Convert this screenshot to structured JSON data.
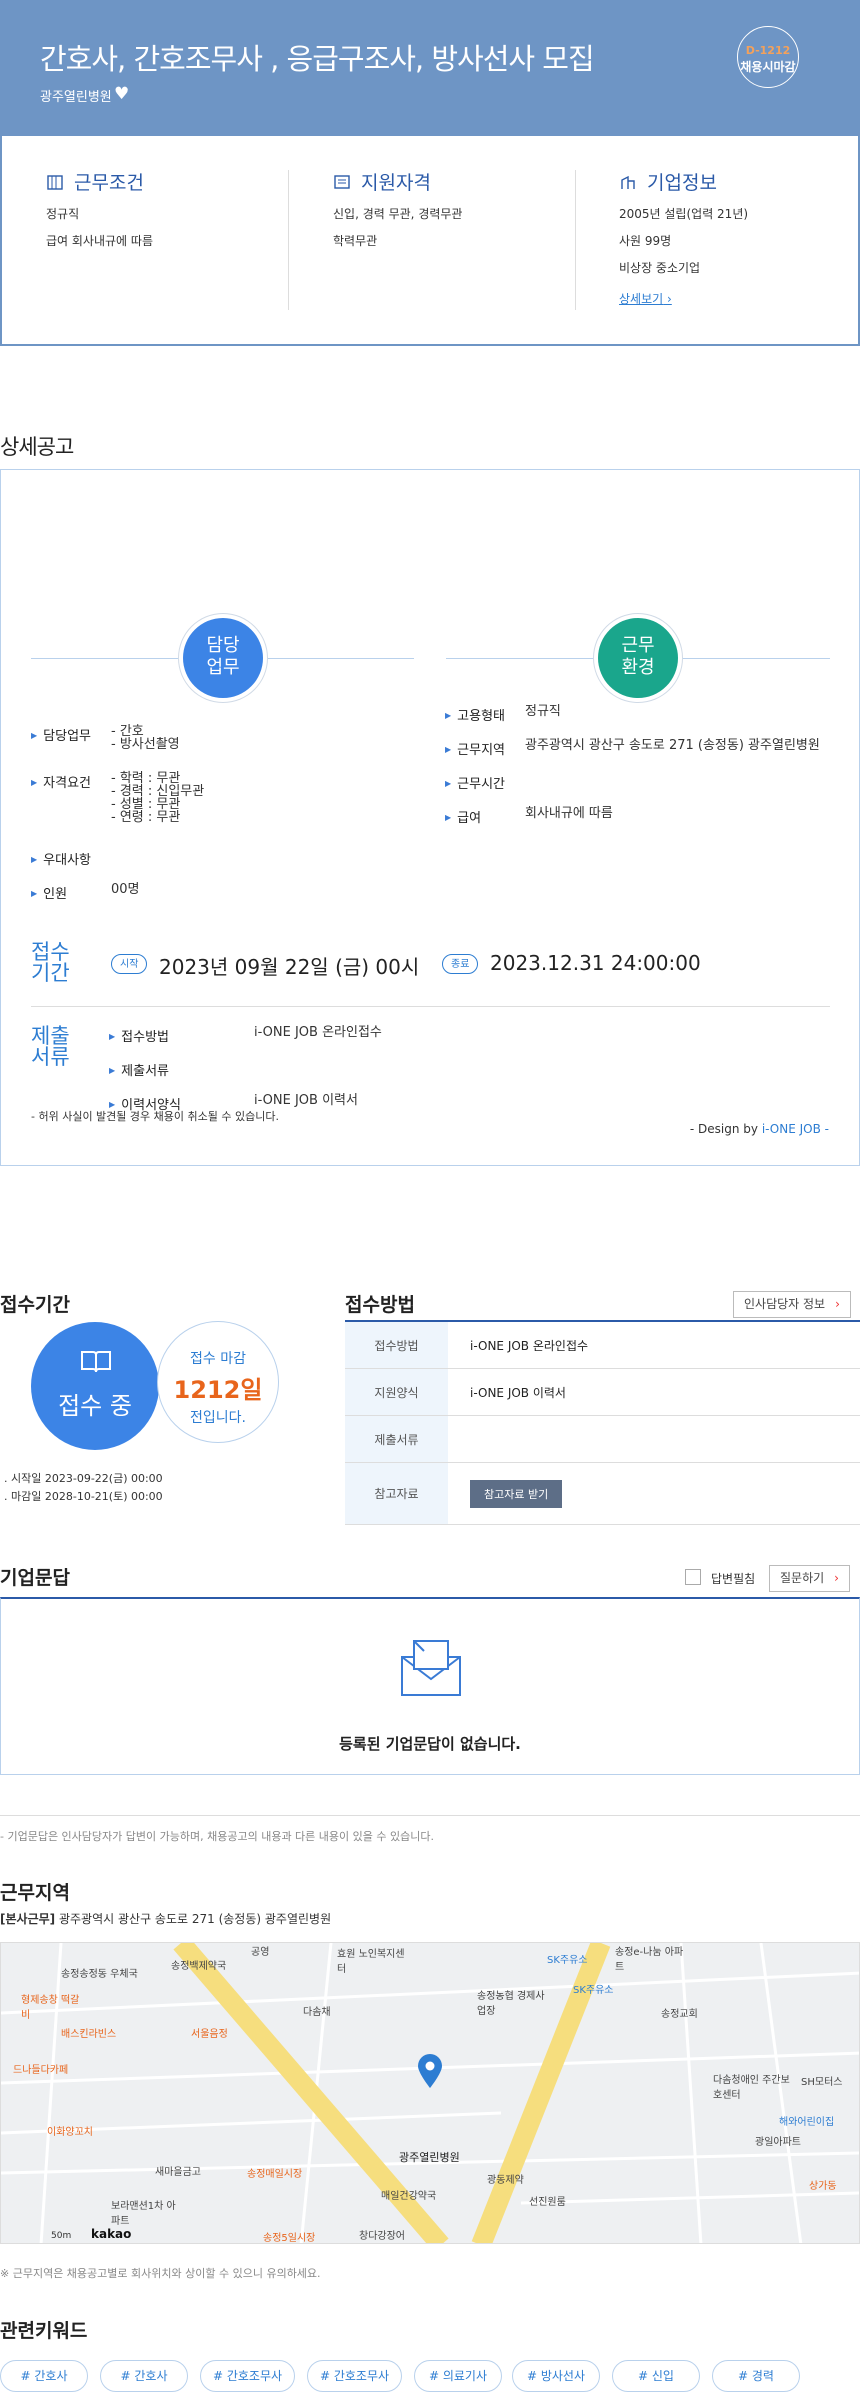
{
  "header": {
    "title": "간호사, 간호조무사 , 응급구조사, 방사선사 모집",
    "company": "광주열린병원",
    "dday": "D-1212",
    "deadline_type": "채용시마감"
  },
  "summary": {
    "work": {
      "title": "근무조건",
      "lines": [
        "정규직",
        "급여 회사내규에 따름"
      ]
    },
    "qual": {
      "title": "지원자격",
      "lines": [
        "신입, 경력 무관, 경력무관",
        "학력무관"
      ]
    },
    "company": {
      "title": "기업정보",
      "lines": [
        "2005년 설립(업력 21년)",
        "사원 99명",
        "비상장 중소기업"
      ],
      "link": "상세보기"
    }
  },
  "detail": {
    "heading": "상세공고",
    "duty_circle": "담당\n업무",
    "env_circle": "근무\n환경",
    "left_rows": [
      {
        "label": "담당업무",
        "value": "- 간호\n- 방사선촬영"
      },
      {
        "label": "자격요건",
        "value": "- 학력 : 무관\n- 경력 : 신입무관\n- 성별 : 무관\n- 연령 : 무관"
      },
      {
        "label": "우대사항",
        "value": ""
      },
      {
        "label": "인원",
        "value": "00명"
      }
    ],
    "right_rows": [
      {
        "label": "고용형태",
        "value": "정규직"
      },
      {
        "label": "근무지역",
        "value": "광주광역시 광산구 송도로 271 (송정동) 광주열린병원"
      },
      {
        "label": "근무시간",
        "value": ""
      },
      {
        "label": "급여",
        "value": "회사내규에 따름"
      }
    ],
    "period_label": "접수\n기간",
    "start_pill": "시작",
    "start": "2023년 09월 22일 (금) 00시",
    "end_pill": "종료",
    "end": "2023.12.31 24:00:00",
    "docs_label": "제출\n서류",
    "docs_rows": [
      {
        "label": "접수방법",
        "value": "i-ONE JOB 온라인접수"
      },
      {
        "label": "제출서류",
        "value": ""
      },
      {
        "label": "이력서양식",
        "value": "i-ONE JOB 이력서"
      }
    ],
    "warning": "- 허위 사실이 발견될 경우 채용이 취소될 수 있습니다.",
    "design_by": "- Design by ",
    "design_brand": "i-ONE JOB -"
  },
  "period": {
    "heading": "접수기간",
    "status": "접수 중",
    "remain_label": "접수 마감",
    "remain_days": "1212일",
    "remain_suffix": "전입니다.",
    "start_line": "시작일 2023-09-22(금) 00:00",
    "end_line": "마감일 2028-10-21(토) 00:00"
  },
  "method": {
    "heading": "접수방법",
    "hr_button": "인사담당자 정보",
    "rows": [
      {
        "th": "접수방법",
        "td": "i-ONE JOB 온라인접수"
      },
      {
        "th": "지원양식",
        "td": "i-ONE JOB 이력서"
      },
      {
        "th": "제출서류",
        "td": ""
      },
      {
        "th": "참고자료",
        "td": ""
      }
    ],
    "ref_button": "참고자료 받기"
  },
  "qa": {
    "heading": "기업문답",
    "answered": "답변필침",
    "ask_button": "질문하기",
    "empty": "등록된 기업문답이 없습니다.",
    "note": "- 기업문답은 인사담당자가 답변이 가능하며, 채용공고의 내용과 다른 내용이 있을 수 있습니다."
  },
  "location": {
    "heading": "근무지역",
    "tag": "[본사근무]",
    "address": "광주광역시 광산구 송도로 271 (송정동) 광주열린병원",
    "map_labels": [
      "송정백제약국",
      "공영",
      "효원 노인복지센터",
      "SK주유소",
      "송정e-나눔 아파트",
      "송정송정동 우체국",
      "다솜채",
      "송정농협 경제사업장",
      "SK주유소",
      "송정교회",
      "서울음정",
      "배스킨라빈스",
      "형제송창 떡갈비",
      "드나들다카페",
      "이화양꼬치",
      "새마을금고",
      "송정매일시장",
      "광주열린병원",
      "광동제약",
      "선진원룸",
      "매일건강약국",
      "보라맨션1차 아파트",
      "송정5일시장",
      "창다강장어",
      "다솜청애인 주간보호센터",
      "SH모터스",
      "해와어린이집",
      "광일아파트",
      "상가동"
    ],
    "map_scale": "50m",
    "map_brand": "kakao",
    "note": "※ 근무지역은 채용공고별로 회사위치와 상이할 수 있으니 유의하세요."
  },
  "keywords": {
    "heading": "관련키워드",
    "items": [
      "# 간호사",
      "# 간호사",
      "# 간호조무사",
      "# 간호조무사",
      "# 의료기사",
      "# 방사선사",
      "# 신입",
      "# 경력"
    ]
  },
  "colors": {
    "header_bg": "#6e95c5",
    "accent": "#2d7dd2",
    "orange": "#e8651c",
    "teal": "#1aa68c"
  }
}
